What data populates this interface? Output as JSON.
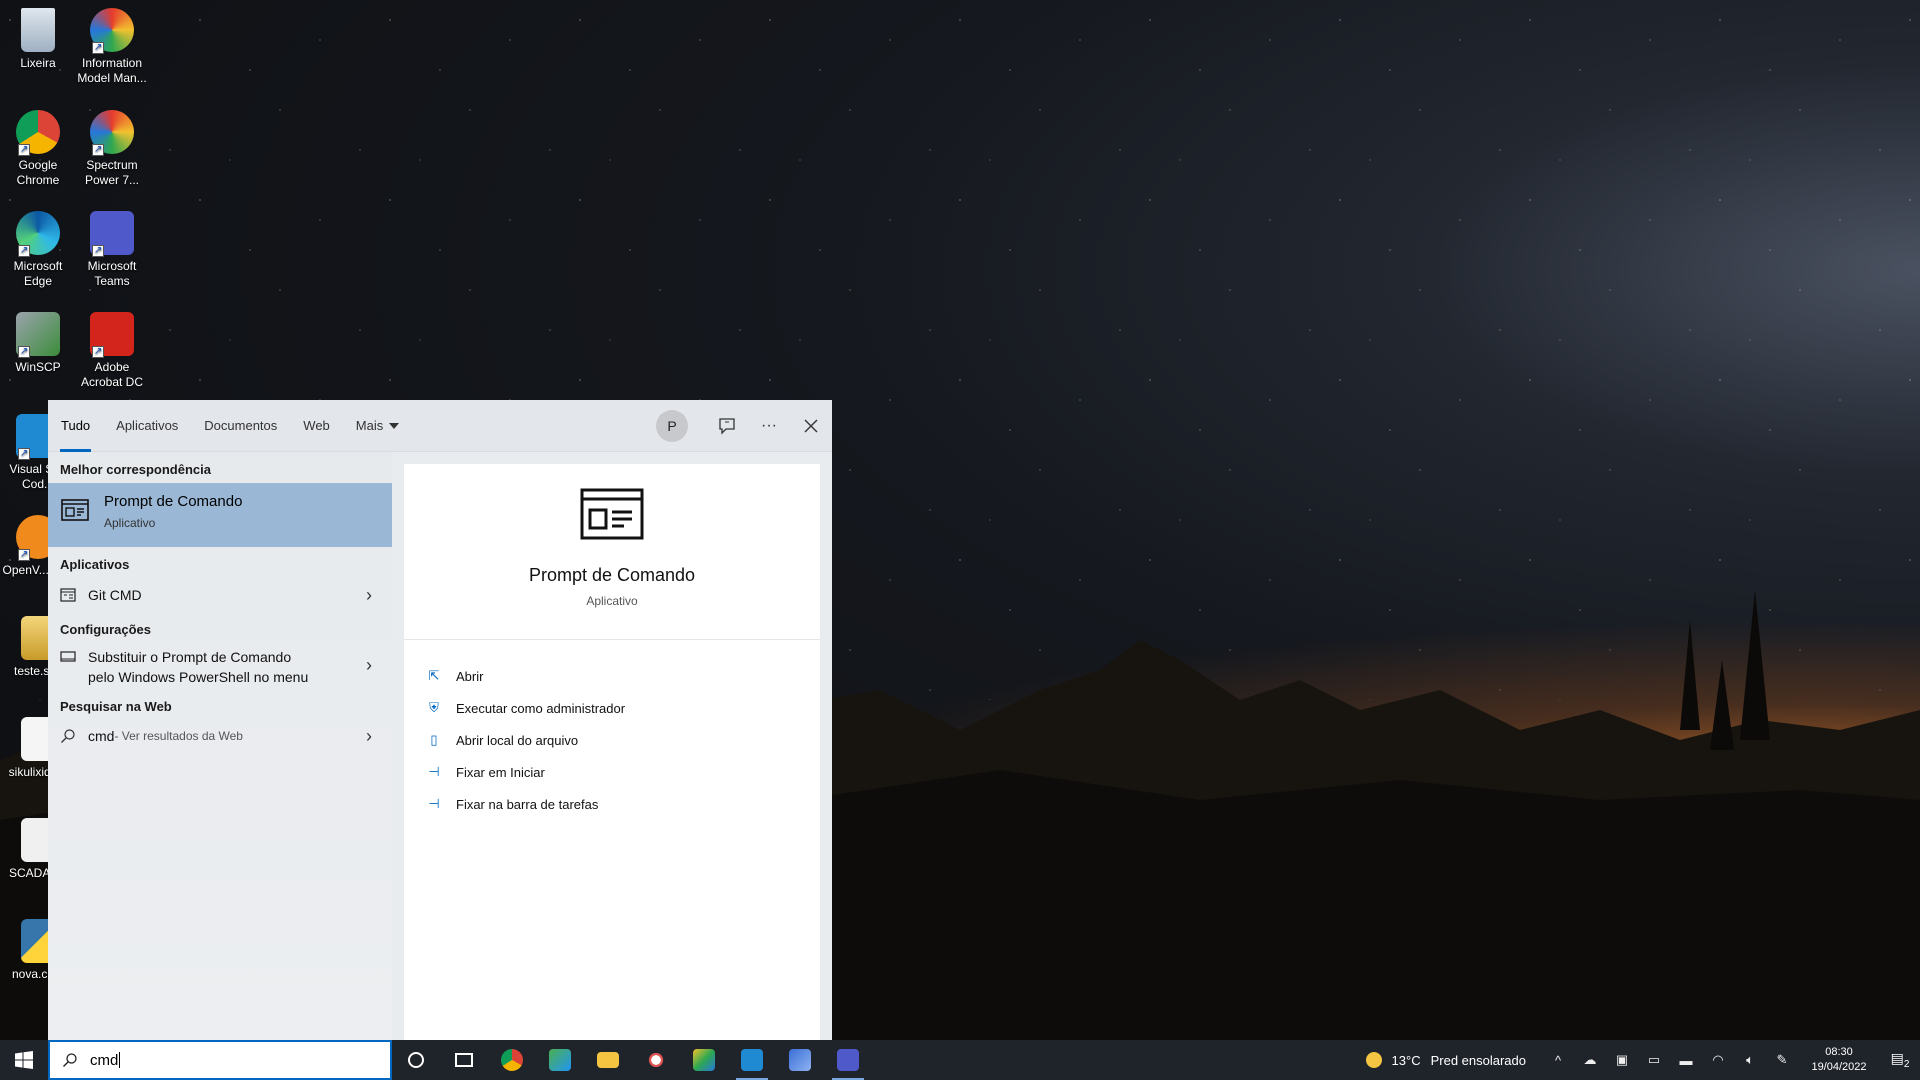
{
  "desktop_icons": [
    {
      "label": "Lixeira",
      "icon": "recycle-bin-icon"
    },
    {
      "label": "Information Model Man...",
      "icon": "spectrum-7-icon"
    },
    {
      "label": "Google Chrome",
      "icon": "chrome-icon"
    },
    {
      "label": "Spectrum Power 7...",
      "icon": "spectrum-7-icon"
    },
    {
      "label": "Microsoft Edge",
      "icon": "edge-icon"
    },
    {
      "label": "Microsoft Teams",
      "icon": "teams-icon"
    },
    {
      "label": "WinSCP",
      "icon": "winscp-icon"
    },
    {
      "label": "Adobe Acrobat DC",
      "icon": "acrobat-icon"
    },
    {
      "label": "Visual St... Cod...",
      "icon": "vscode-icon"
    },
    {
      "label": "OpenV... GUI",
      "icon": "openvpn-icon"
    },
    {
      "label": "teste.si...",
      "icon": "file-icon"
    },
    {
      "label": "sikulixide...",
      "icon": "java-icon"
    },
    {
      "label": "SCADA.t...",
      "icon": "text-file-icon"
    },
    {
      "label": "nova.cp...",
      "icon": "python-icon"
    }
  ],
  "tabs": [
    {
      "label": "Tudo",
      "active": true
    },
    {
      "label": "Aplicativos",
      "active": false
    },
    {
      "label": "Documentos",
      "active": false
    },
    {
      "label": "Web",
      "active": false
    },
    {
      "label": "Mais",
      "active": false
    }
  ],
  "avatar_initial": "P",
  "left": {
    "best_header": "Melhor correspondência",
    "best_title": "Prompt de Comando",
    "best_sub": "Aplicativo",
    "apps_header": "Aplicativos",
    "apps_item": "Git CMD",
    "settings_header": "Configurações",
    "settings_item_line1": "Substituir o Prompt de Comando",
    "settings_item_line2": "pelo Windows PowerShell no menu",
    "web_header": "Pesquisar na Web",
    "web_query": "cmd",
    "web_suffix": " - Ver resultados da Web"
  },
  "right": {
    "name": "Prompt de Comando",
    "type": "Aplicativo",
    "actions": [
      "Abrir",
      "Executar como administrador",
      "Abrir local do arquivo",
      "Fixar em Iniciar",
      "Fixar na barra de tarefas"
    ]
  },
  "search": {
    "query": "cmd"
  },
  "tray": {
    "temperature": "13°C",
    "weather": "Pred ensolarado",
    "time": "08:30",
    "date": "19/04/2022",
    "notifications": "2"
  },
  "colors": {
    "accent": "#0067c0",
    "selected": "#9ab8d6"
  }
}
